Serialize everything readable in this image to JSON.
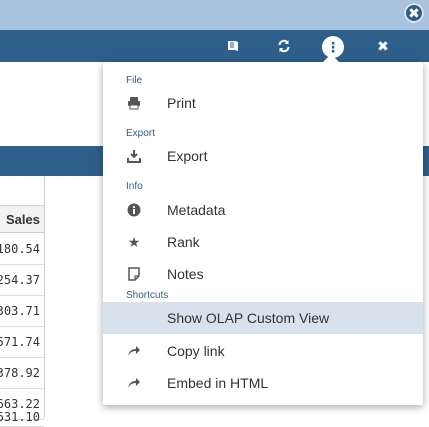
{
  "toolbar": {
    "close_icon": "close-circle-icon",
    "book_icon": "book-icon",
    "refresh_icon": "refresh-icon",
    "more_icon": "more-vertical-icon",
    "close_x_icon": "close-icon"
  },
  "table": {
    "header": "Sales",
    "rows": [
      "180.54",
      "254.37",
      "303.71",
      "571.74",
      "378.92",
      "663.22",
      "631.10"
    ]
  },
  "menu": {
    "sections": {
      "file": "File",
      "export": "Export",
      "info": "Info",
      "shortcuts": "Shortcuts"
    },
    "items": [
      {
        "label": "Print",
        "icon": "print-icon"
      },
      {
        "label": "Export",
        "icon": "download-icon"
      },
      {
        "label": "Metadata",
        "icon": "info-icon"
      },
      {
        "label": "Rank",
        "icon": "star-icon"
      },
      {
        "label": "Notes",
        "icon": "note-icon"
      },
      {
        "label": "Show OLAP Custom View",
        "icon": ""
      },
      {
        "label": "Copy link",
        "icon": "share-arrow-icon"
      },
      {
        "label": "Embed in HTML",
        "icon": "share-arrow-icon"
      }
    ]
  },
  "colors": {
    "toolbar": "#2e5f8b",
    "top_strip": "#a9c3dc",
    "highlight": "#d7e2ec",
    "section_label": "#2e5f8b"
  }
}
